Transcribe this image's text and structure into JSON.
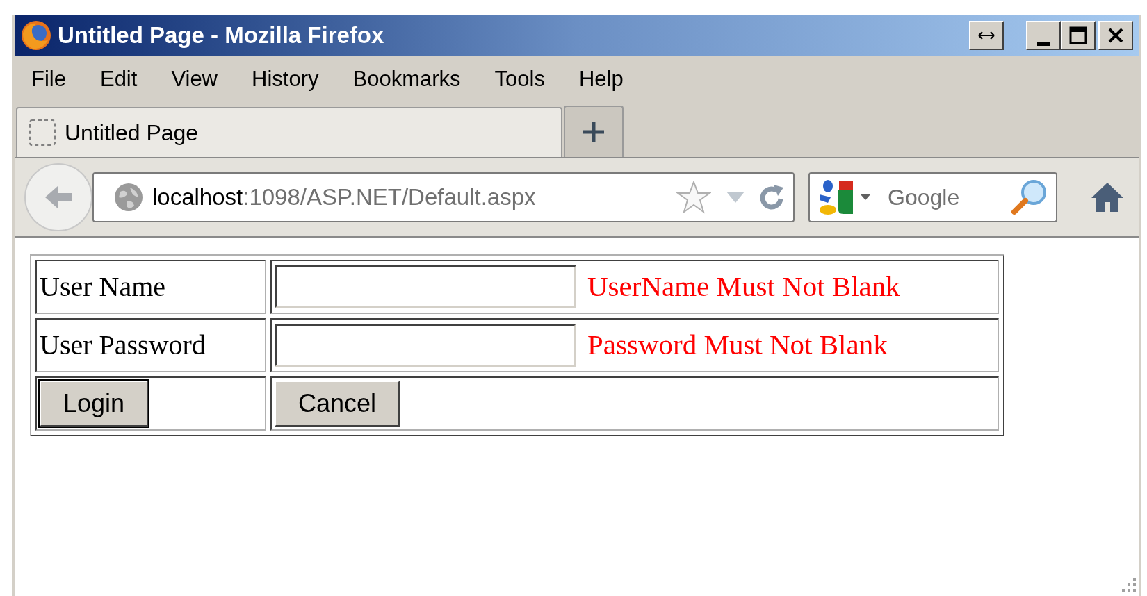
{
  "window": {
    "title": "Untitled Page - Mozilla Firefox"
  },
  "menu": [
    "File",
    "Edit",
    "View",
    "History",
    "Bookmarks",
    "Tools",
    "Help"
  ],
  "tabs": [
    {
      "label": "Untitled Page",
      "selected": true
    }
  ],
  "address": {
    "host": "localhost",
    "path": ":1098/ASP.NET/Default.aspx"
  },
  "search": {
    "placeholder": "Google"
  },
  "form": {
    "rows": [
      {
        "kind": "field",
        "label": "User Name",
        "error": "UserName Must Not Blank"
      },
      {
        "kind": "field",
        "label": "User Password",
        "error": "Password Must Not Blank"
      },
      {
        "kind": "buttons",
        "buttons": [
          "Login",
          "Cancel"
        ]
      }
    ]
  }
}
